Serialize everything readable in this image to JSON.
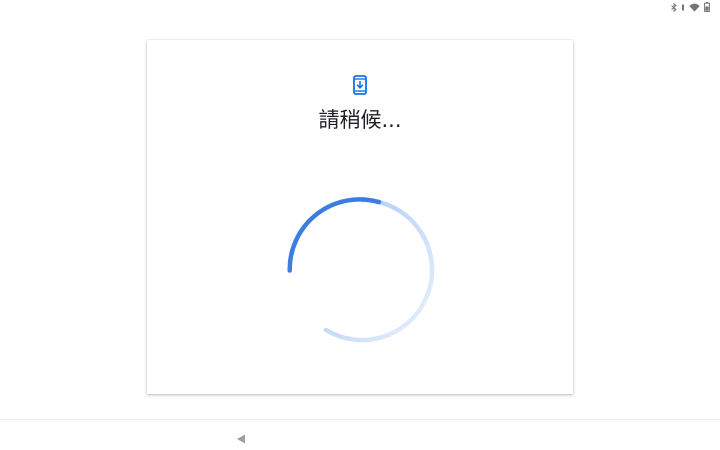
{
  "status_bar": {
    "icons": [
      "bluetooth-icon",
      "vibrate-icon",
      "wifi-icon",
      "battery-icon"
    ],
    "icon_color": "#757575"
  },
  "card": {
    "icon": "phone-download-icon",
    "icon_color": "#1a73e8",
    "title": "請稍候..."
  },
  "spinner": {
    "icon": "progress-spinner",
    "colors": [
      "#3b7ee0",
      "#a8c7f5",
      "#dce8fb"
    ]
  },
  "nav_bar": {
    "icons": [
      "back-icon"
    ],
    "icon_color": "#9e9e9e"
  }
}
